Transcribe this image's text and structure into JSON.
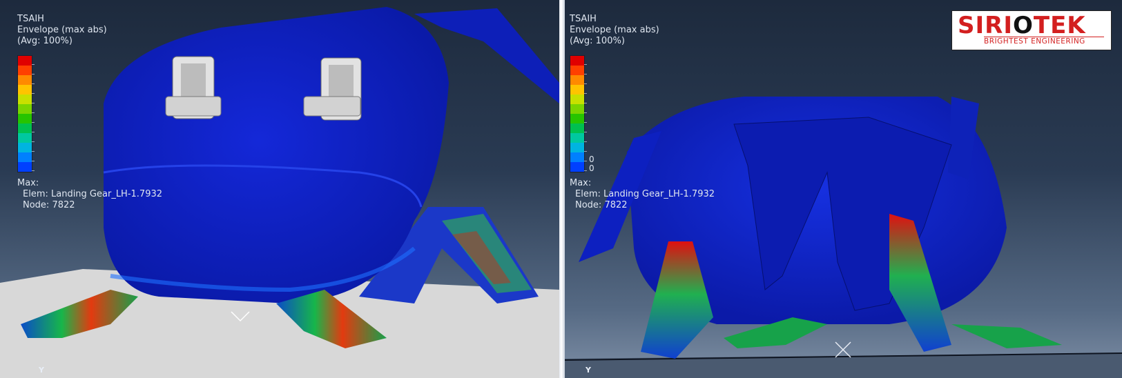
{
  "legend": {
    "variable": "TSAIH",
    "envelope": "Envelope (max abs)",
    "avg": "(Avg: 100%)",
    "colors": [
      "#e00000",
      "#ff4000",
      "#ff8a00",
      "#ffc400",
      "#c8e000",
      "#7ad400",
      "#26c400",
      "#00c050",
      "#00c8a0",
      "#00b4e0",
      "#0080ff",
      "#0040ff"
    ]
  },
  "max_info": {
    "label": "Max:",
    "elem": "Elem: Landing Gear_LH-1.7932",
    "node": "Node: 7822"
  },
  "right_zero_labels": [
    "0",
    "0"
  ],
  "axis_label": "Y",
  "brand": {
    "name_red": "SIRI",
    "name_dark": "O",
    "name_red2": "TEK",
    "tagline": "BRIGHTEST ENGINEERING",
    "color": "#d31f1f"
  }
}
